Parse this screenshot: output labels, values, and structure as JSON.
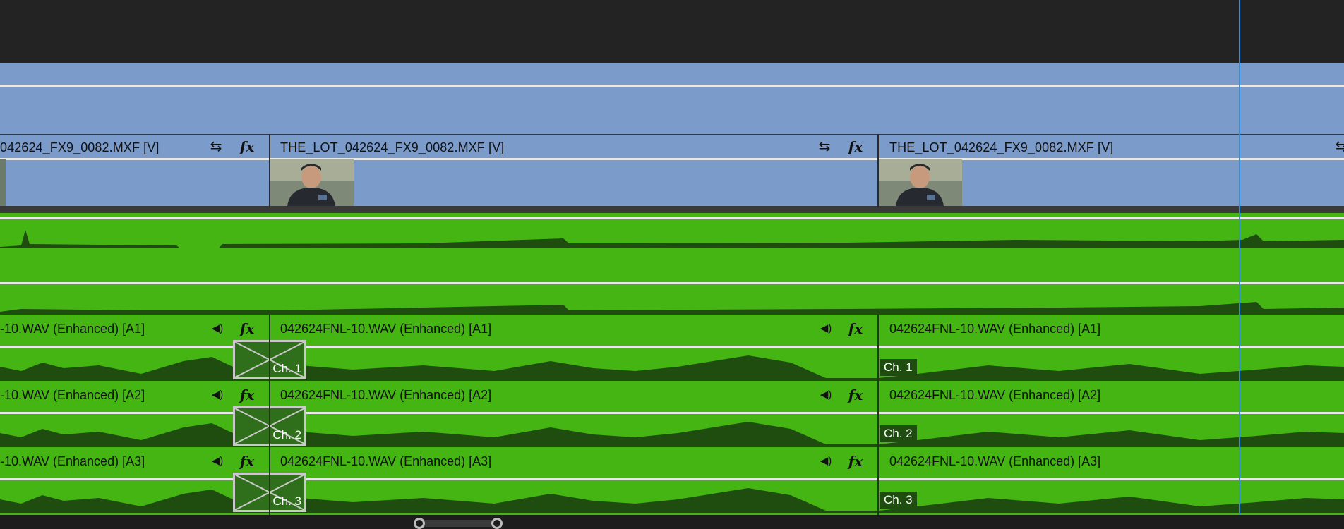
{
  "video_track": {
    "clips": [
      {
        "label": "042624_FX9_0082.MXF [V]",
        "icons": [
          "sync-icon",
          "fx-icon"
        ]
      },
      {
        "label": "THE_LOT_042624_FX9_0082.MXF [V]",
        "icons": [
          "sync-icon",
          "fx-icon"
        ]
      },
      {
        "label": "THE_LOT_042624_FX9_0082.MXF [V]",
        "icons": [
          "sync-icon"
        ]
      }
    ],
    "fx_glyph": "fx",
    "sync_glyph": "⇆"
  },
  "audio_tracks": [
    {
      "track": "A1",
      "clips": [
        {
          "label": "-10.WAV (Enhanced) [A1]"
        },
        {
          "label": "042624FNL-10.WAV (Enhanced) [A1]"
        },
        {
          "label": "042624FNL-10.WAV (Enhanced) [A1]"
        }
      ],
      "transition_label": "Ch. 1",
      "channel_badge": "Ch. 1"
    },
    {
      "track": "A2",
      "clips": [
        {
          "label": "-10.WAV (Enhanced) [A2]"
        },
        {
          "label": "042624FNL-10.WAV (Enhanced) [A2]"
        },
        {
          "label": "042624FNL-10.WAV (Enhanced) [A2]"
        }
      ],
      "transition_label": "Ch. 2",
      "channel_badge": "Ch. 2"
    },
    {
      "track": "A3",
      "clips": [
        {
          "label": "-10.WAV (Enhanced) [A3]"
        },
        {
          "label": "042624FNL-10.WAV (Enhanced) [A3]"
        },
        {
          "label": "042624FNL-10.WAV (Enhanced) [A3]"
        }
      ],
      "transition_label": "Ch. 3",
      "channel_badge": "Ch. 3"
    }
  ],
  "speaker_glyph": "◀)",
  "colors": {
    "video_clip": "#7b9bca",
    "audio_clip": "#45b514",
    "waveform": "#1f4d0f",
    "playhead": "#2f8fe0",
    "background": "#232323"
  }
}
